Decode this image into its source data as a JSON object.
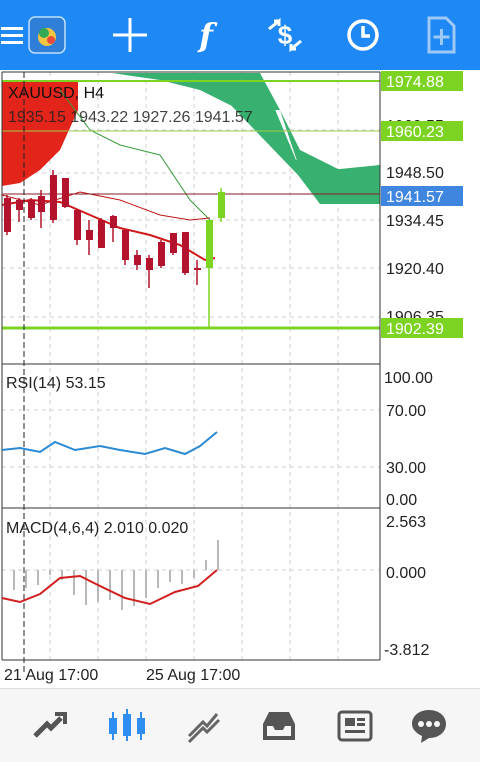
{
  "toolbar": {
    "items": [
      {
        "name": "menu-icon"
      },
      {
        "name": "app-logo-icon"
      },
      {
        "name": "crosshair-icon"
      },
      {
        "name": "indicators-icon",
        "glyph": "f"
      },
      {
        "name": "symbol-dollar-icon"
      },
      {
        "name": "clock-icon"
      },
      {
        "name": "add-object-icon"
      }
    ],
    "color": "#1e88f5"
  },
  "chart": {
    "header": "XAUUSD, H4",
    "ohlc": "1935.15 1943.22 1927.26 1941.57",
    "price_levels": {
      "ask_label": "1974.88",
      "line_2": "1960.23",
      "current": "1941.57",
      "low_line": "1902.39"
    },
    "price_ticks": [
      "1960.55",
      "1948.50",
      "1934.45",
      "1920.40",
      "1906.35"
    ],
    "rsi": {
      "label": "RSI(14) 53.15",
      "ticks": [
        "100.00",
        "70.00",
        "30.00",
        "0.00"
      ]
    },
    "macd": {
      "label": "MACD(4,6,4) 2.010 0.020",
      "ticks": [
        "2.563",
        "0.000",
        "-3.812"
      ]
    },
    "time_labels": [
      "21 Aug 17:00",
      "25 Aug 17:00"
    ],
    "colors": {
      "bull": "#7cd321",
      "bear": "#b3132c",
      "cloud_red": "#e3241b",
      "cloud_green": "#38b070",
      "level_green": "#7cd321",
      "current_price": "#3f86e0",
      "rsi_line": "#2a8ad4",
      "macd_line": "#d21e1e"
    }
  },
  "bottom_nav": {
    "items": [
      {
        "name": "quotes-tab-icon",
        "active": false
      },
      {
        "name": "chart-tab-icon",
        "active": true
      },
      {
        "name": "trade-tab-icon",
        "active": false
      },
      {
        "name": "history-tab-icon",
        "active": false
      },
      {
        "name": "news-tab-icon",
        "active": false
      },
      {
        "name": "chat-tab-icon",
        "active": false
      }
    ]
  }
}
